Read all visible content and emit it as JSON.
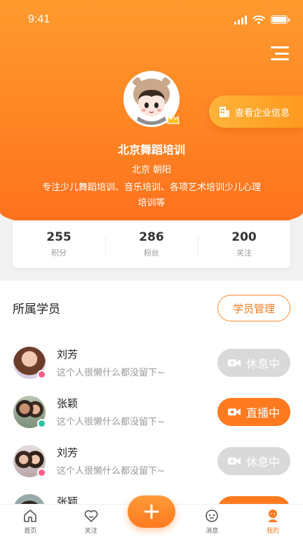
{
  "status_bar": {
    "time": "9:41"
  },
  "profile": {
    "name": "北京舞蹈培训",
    "location": "北京 朝阳",
    "description": "专注少儿舞蹈培训、音乐培训、各项艺术培训少儿心理培训等",
    "company_button": "查看企业信息"
  },
  "stats": [
    {
      "value": "255",
      "label": "积分"
    },
    {
      "value": "286",
      "label": "粉丝"
    },
    {
      "value": "200",
      "label": "关注"
    }
  ],
  "students_section": {
    "title": "所属学员",
    "manage_button": "学员管理",
    "items": [
      {
        "name": "刘芳",
        "signature": "这个人很懒什么都没留下~",
        "status": "休息中",
        "live": false,
        "badge_color": "#ff5c8a"
      },
      {
        "name": "张颖",
        "signature": "这个人很懒什么都没留下~",
        "status": "直播中",
        "live": true,
        "badge_color": "#2cc6a4"
      },
      {
        "name": "刘芳",
        "signature": "这个人很懒什么都没留下~",
        "status": "休息中",
        "live": false,
        "badge_color": "#ff5c8a"
      },
      {
        "name": "张颖",
        "signature": "",
        "status": "",
        "live": true,
        "badge_color": "#2cc6a4"
      }
    ]
  },
  "tabbar": {
    "items": [
      {
        "label": "首页",
        "icon": "home-icon",
        "active": false
      },
      {
        "label": "关注",
        "icon": "heart-icon",
        "active": false
      },
      {
        "label": "消息",
        "icon": "message-icon",
        "active": false
      },
      {
        "label": "我的",
        "icon": "user-icon",
        "active": true
      }
    ],
    "center_button_icon": "plus-icon"
  },
  "colors": {
    "accent": "#ff7a1e",
    "hero_top": "#ff9a2e",
    "rest_button": "#d9d9d9"
  }
}
